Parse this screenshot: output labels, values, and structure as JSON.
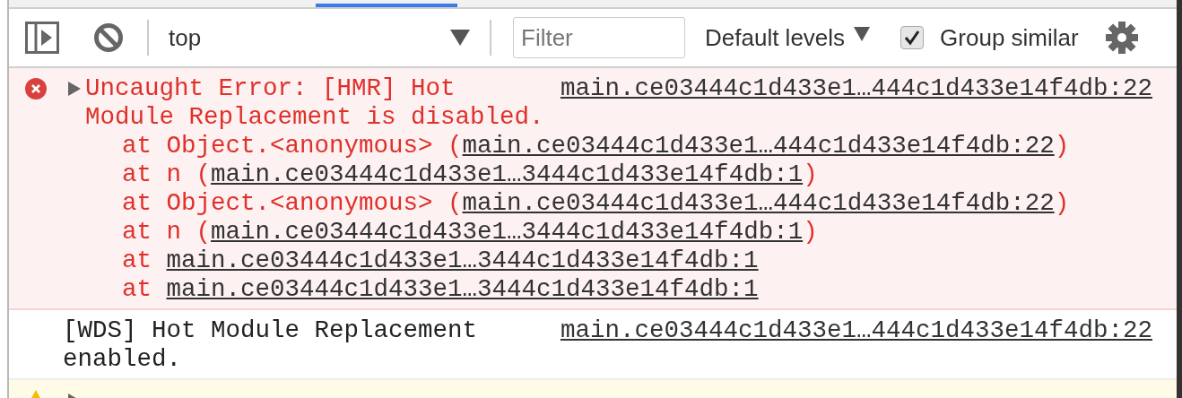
{
  "toolbar": {
    "context": "top",
    "filter": {
      "placeholder": "Filter"
    },
    "levels": "Default levels",
    "group_similar": {
      "label": "Group similar",
      "checked": true
    }
  },
  "messages": [
    {
      "kind": "error",
      "text": "Uncaught Error: [HMR] Hot Module Replacement is disabled.",
      "source": "main.ce03444c1d433e1…444c1d433e14f4db:22",
      "stack": [
        {
          "prefix": "at Object.<anonymous> (",
          "link": "main.ce03444c1d433e1…444c1d433e14f4db:22",
          "suffix": ")"
        },
        {
          "prefix": "at n (",
          "link": "main.ce03444c1d433e1…3444c1d433e14f4db:1",
          "suffix": ")"
        },
        {
          "prefix": "at Object.<anonymous> (",
          "link": "main.ce03444c1d433e1…444c1d433e14f4db:22",
          "suffix": ")"
        },
        {
          "prefix": "at n (",
          "link": "main.ce03444c1d433e1…3444c1d433e14f4db:1",
          "suffix": ")"
        },
        {
          "prefix": "at ",
          "link": "main.ce03444c1d433e1…3444c1d433e14f4db:1"
        },
        {
          "prefix": "at ",
          "link": "main.ce03444c1d433e1…3444c1d433e14f4db:1"
        }
      ]
    },
    {
      "kind": "info",
      "text": "[WDS] Hot Module Replacement enabled.",
      "source": "main.ce03444c1d433e1…444c1d433e14f4db:22"
    },
    {
      "kind": "warning"
    }
  ]
}
